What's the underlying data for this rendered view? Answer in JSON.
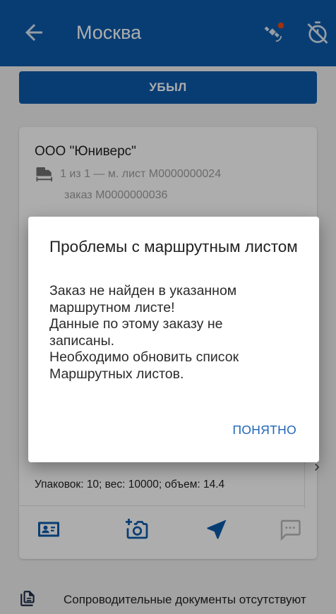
{
  "appbar": {
    "title": "Москва",
    "background": "#0d5bab",
    "icons": [
      "back-arrow-icon",
      "gps-satellite-icon",
      "timer-off-icon"
    ]
  },
  "main_button": {
    "label": "УБЫЛ",
    "color": "#0d5bab"
  },
  "card": {
    "company": "ООО \"Юниверс\"",
    "route_line": "1 из 1 — м. лист М0000000024",
    "order_line": "заказ М0000000036",
    "packages": "Упаковок: 10; вес: 10000; объем: 14.4",
    "actions": [
      "contact-card-icon",
      "add-photo-icon",
      "navigation-arrow-icon",
      "chat-icon"
    ]
  },
  "footer": {
    "text": "Сопроводительные документы отсутствуют",
    "icon": "documents-icon"
  },
  "dialog": {
    "title": "Проблемы с маршрутным листом",
    "body_lines": [
      "Заказ не найден в указанном",
      "маршрутном листе!",
      "Данные по этому заказу не",
      "записаны.",
      "Необходимо обновить список",
      "Маршрутных листов."
    ],
    "ok_label": "ПОНЯТНО",
    "accent": "#1f65b8"
  }
}
